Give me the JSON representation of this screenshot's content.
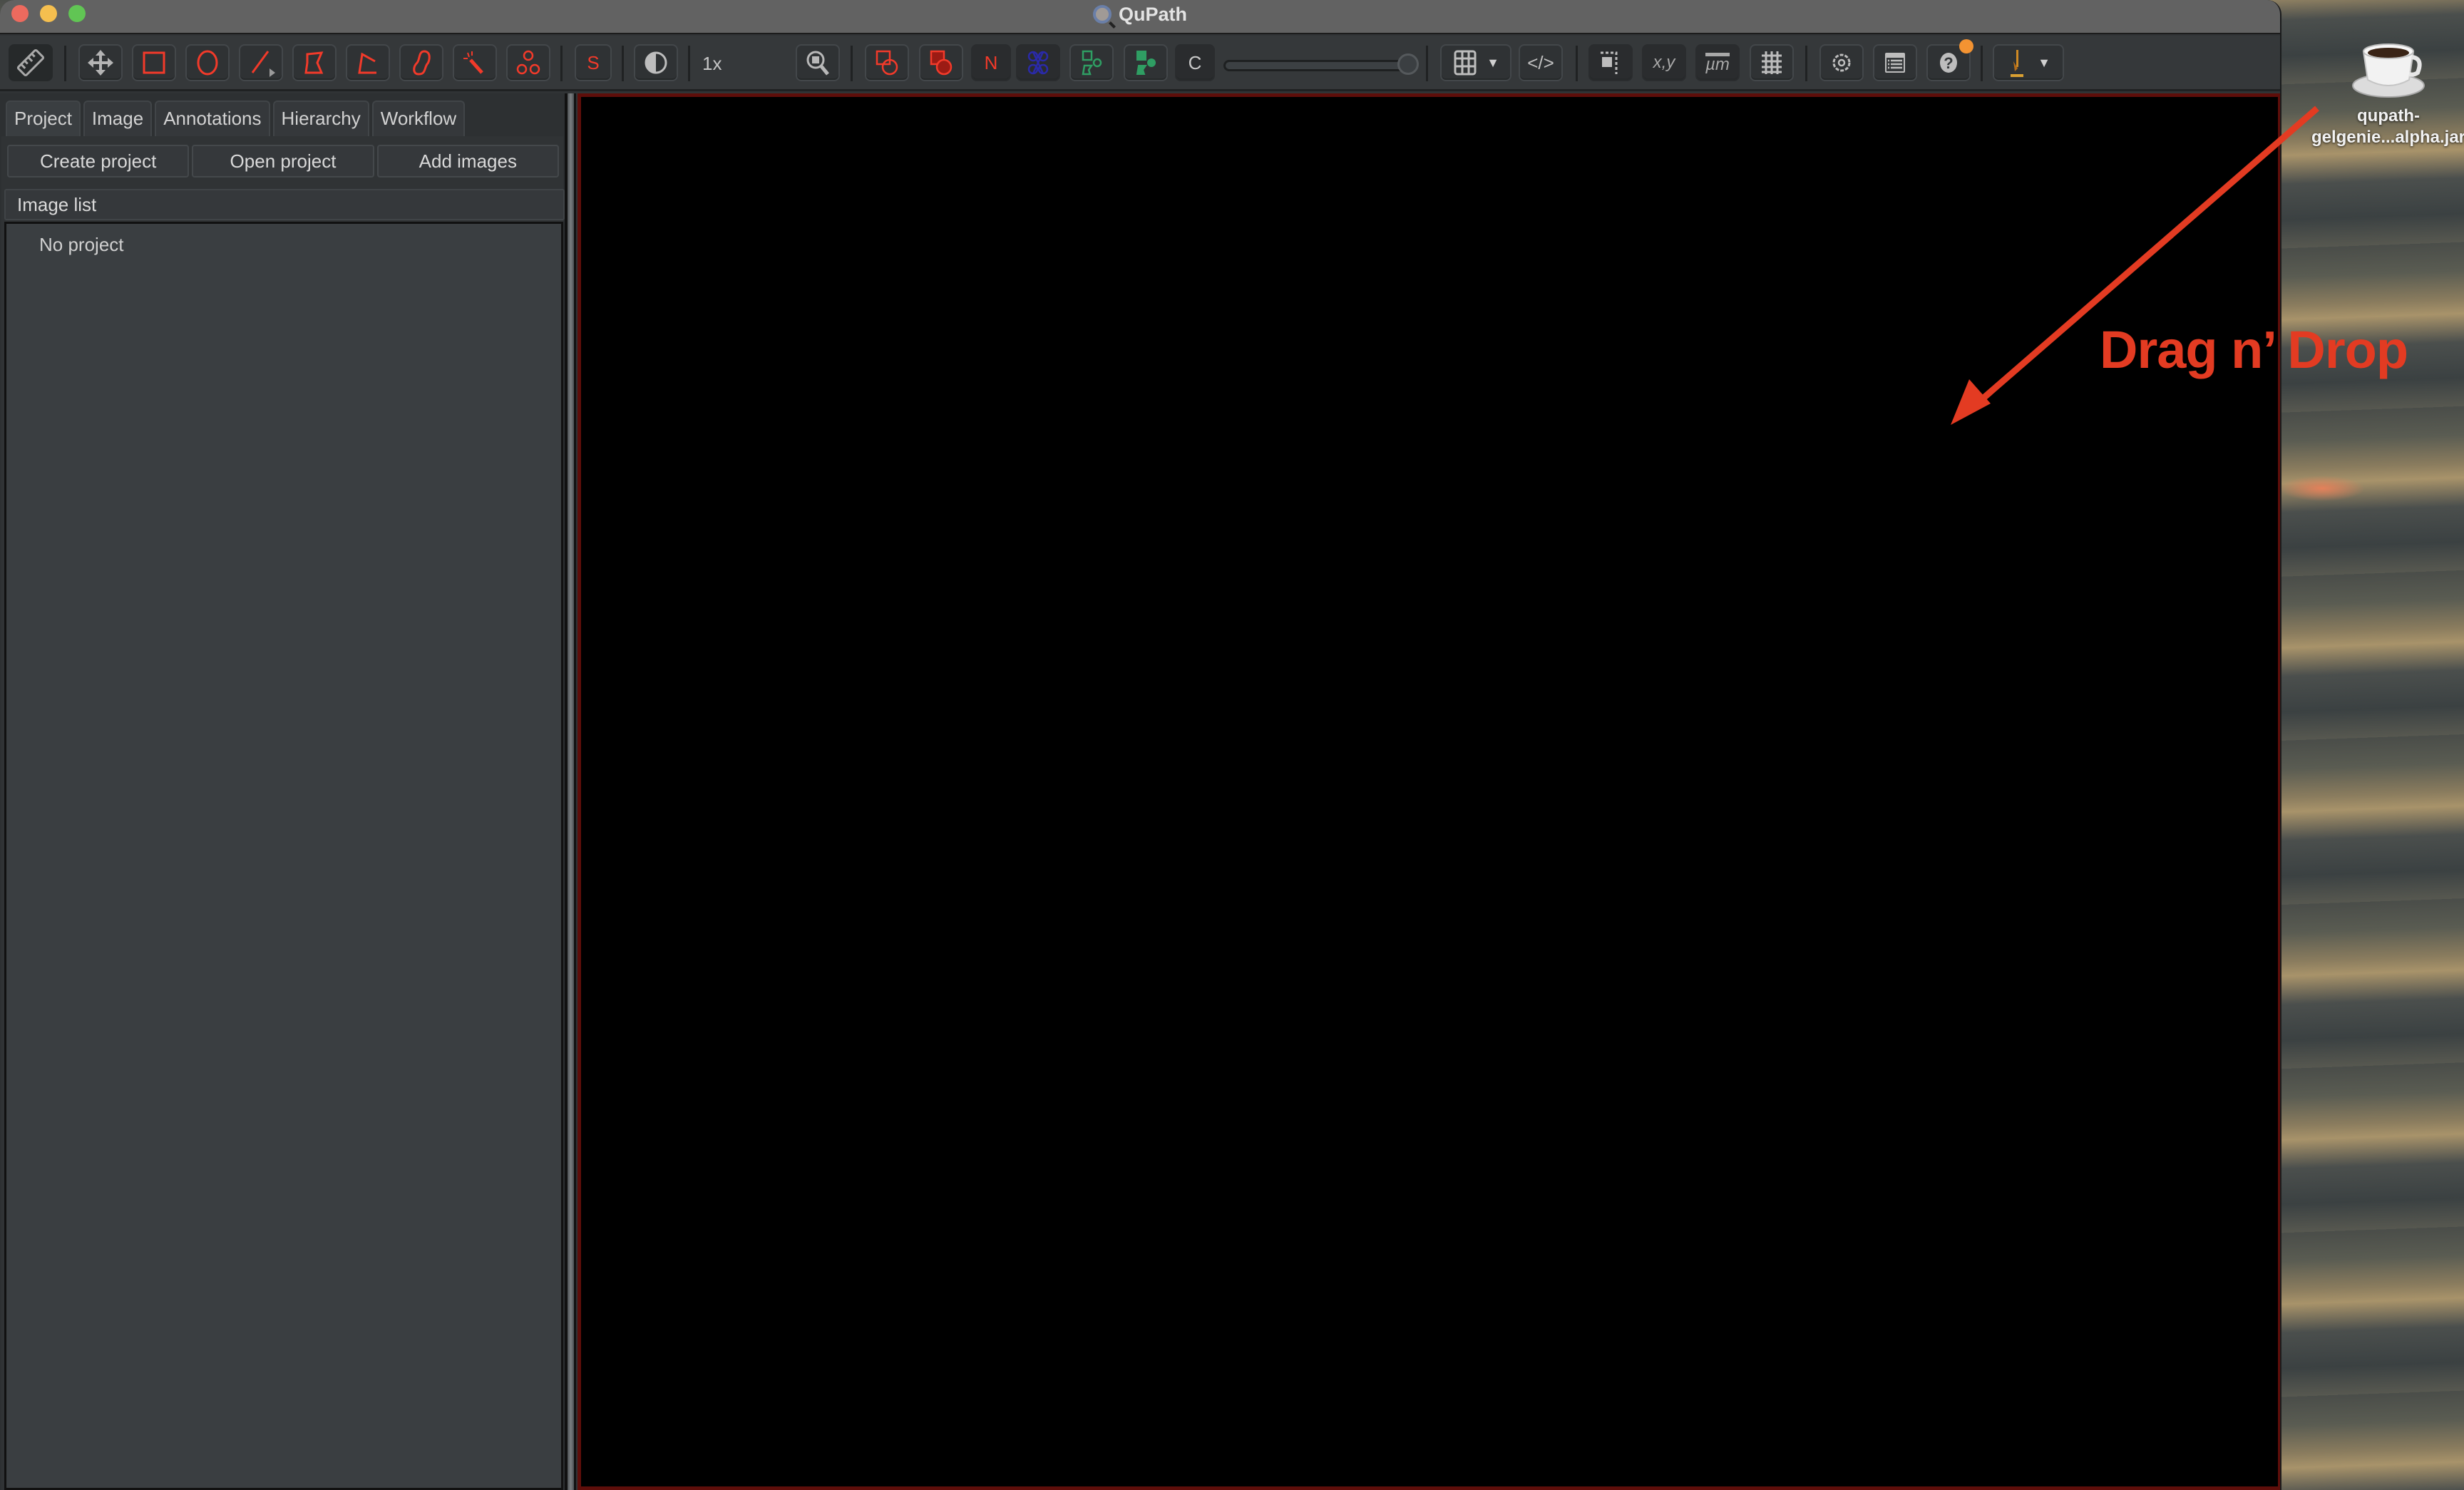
{
  "window": {
    "title": "QuPath",
    "traffic_lights": [
      "close",
      "minimize",
      "zoom"
    ]
  },
  "toolbar": {
    "tools": [
      {
        "name": "measure-mode",
        "icon": "ruler-icon",
        "state": "selected"
      },
      {
        "name": "move-tool",
        "icon": "move-arrows-icon"
      },
      {
        "name": "rectangle-tool",
        "icon": "rectangle-icon"
      },
      {
        "name": "ellipse-tool",
        "icon": "ellipse-icon"
      },
      {
        "name": "line-tool",
        "icon": "line-icon",
        "has_menu": true
      },
      {
        "name": "polygon-tool",
        "icon": "polygon-icon"
      },
      {
        "name": "polyline-tool",
        "icon": "polyline-icon"
      },
      {
        "name": "brush-tool",
        "icon": "brush-icon"
      },
      {
        "name": "wand-tool",
        "icon": "wand-icon"
      },
      {
        "name": "points-tool",
        "icon": "points-icon"
      },
      {
        "name": "selection-mode",
        "icon": "s-icon",
        "label": "S"
      },
      {
        "name": "brightness-contrast",
        "icon": "contrast-icon"
      },
      {
        "name": "zoom-to-fit",
        "icon": "magnifier-icon"
      },
      {
        "name": "show-annotations",
        "icon": "annotations-icon"
      },
      {
        "name": "fill-annotations",
        "icon": "fill-annotations-icon"
      },
      {
        "name": "show-names",
        "icon": "n-icon",
        "label": "N"
      },
      {
        "name": "show-tma-grid",
        "icon": "tma-grid-icon"
      },
      {
        "name": "show-detections",
        "icon": "detections-icon"
      },
      {
        "name": "fill-detections",
        "icon": "fill-detections-icon"
      },
      {
        "name": "show-connections",
        "icon": "c-icon",
        "label": "C"
      },
      {
        "name": "measurement-table",
        "icon": "table-icon",
        "has_menu": true
      },
      {
        "name": "script-editor",
        "icon": "code-icon"
      },
      {
        "name": "show-overview",
        "icon": "overview-icon"
      },
      {
        "name": "show-location",
        "icon": "xy-icon",
        "label": "x,y"
      },
      {
        "name": "show-scalebar",
        "icon": "scalebar-icon",
        "label": "µm"
      },
      {
        "name": "show-grid",
        "icon": "grid-icon"
      },
      {
        "name": "preferences",
        "icon": "gear-icon"
      },
      {
        "name": "log",
        "icon": "log-icon"
      },
      {
        "name": "help",
        "icon": "help-icon",
        "notification": true
      },
      {
        "name": "extensions",
        "icon": "microscope-icon",
        "has_menu": true
      }
    ],
    "zoom_label": "1x",
    "opacity_slider": {
      "value_percent": 100
    },
    "colors": {
      "annotation": "#f23a2a",
      "tma": "#2a2aa8",
      "detection": "#2f9e63",
      "notification": "#f39332"
    }
  },
  "left_panel": {
    "tabs": [
      {
        "label": "Project",
        "active": true
      },
      {
        "label": "Image",
        "active": false
      },
      {
        "label": "Annotations",
        "active": false
      },
      {
        "label": "Hierarchy",
        "active": false
      },
      {
        "label": "Workflow",
        "active": false
      }
    ],
    "buttons": {
      "create_project": "Create project",
      "open_project": "Open project",
      "add_images": "Add images"
    },
    "image_list": {
      "header": "Image list",
      "empty_text": "No project"
    }
  },
  "viewer": {
    "border_color": "#5e0e0a",
    "background": "#000000"
  },
  "desktop": {
    "file_icon": "java-coffee-cup-icon",
    "file_label_line1": "qupath-",
    "file_label_line2": "gelgenie...alpha.jar"
  },
  "annotation_overlay": {
    "text": "Drag n’ Drop",
    "color": "#e33b22"
  }
}
